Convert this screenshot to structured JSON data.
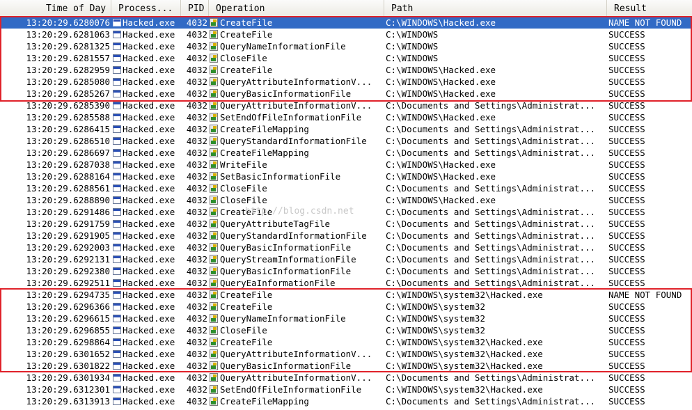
{
  "columns": {
    "time": "Time of Day",
    "process": "Process...",
    "pid": "PID",
    "operation": "Operation",
    "path": "Path",
    "result": "Result"
  },
  "watermark": "http://blog.csdn.net",
  "highlight_color": "#e0222a",
  "selection_color": "#316ac5",
  "rows": [
    {
      "time": "13:20:29.6280076",
      "process": "Hacked.exe",
      "pid": "4032",
      "operation": "CreateFile",
      "path": "C:\\WINDOWS\\Hacked.exe",
      "result": "NAME NOT FOUND",
      "selected": true
    },
    {
      "time": "13:20:29.6281063",
      "process": "Hacked.exe",
      "pid": "4032",
      "operation": "CreateFile",
      "path": "C:\\WINDOWS",
      "result": "SUCCESS"
    },
    {
      "time": "13:20:29.6281325",
      "process": "Hacked.exe",
      "pid": "4032",
      "operation": "QueryNameInformationFile",
      "path": "C:\\WINDOWS",
      "result": "SUCCESS"
    },
    {
      "time": "13:20:29.6281557",
      "process": "Hacked.exe",
      "pid": "4032",
      "operation": "CloseFile",
      "path": "C:\\WINDOWS",
      "result": "SUCCESS"
    },
    {
      "time": "13:20:29.6282959",
      "process": "Hacked.exe",
      "pid": "4032",
      "operation": "CreateFile",
      "path": "C:\\WINDOWS\\Hacked.exe",
      "result": "SUCCESS"
    },
    {
      "time": "13:20:29.6285080",
      "process": "Hacked.exe",
      "pid": "4032",
      "operation": "QueryAttributeInformationV...",
      "path": "C:\\WINDOWS\\Hacked.exe",
      "result": "SUCCESS"
    },
    {
      "time": "13:20:29.6285267",
      "process": "Hacked.exe",
      "pid": "4032",
      "operation": "QueryBasicInformationFile",
      "path": "C:\\WINDOWS\\Hacked.exe",
      "result": "SUCCESS"
    },
    {
      "time": "13:20:29.6285390",
      "process": "Hacked.exe",
      "pid": "4032",
      "operation": "QueryAttributeInformationV...",
      "path": "C:\\Documents and Settings\\Administrat...",
      "result": "SUCCESS"
    },
    {
      "time": "13:20:29.6285588",
      "process": "Hacked.exe",
      "pid": "4032",
      "operation": "SetEndOfFileInformationFile",
      "path": "C:\\WINDOWS\\Hacked.exe",
      "result": "SUCCESS"
    },
    {
      "time": "13:20:29.6286415",
      "process": "Hacked.exe",
      "pid": "4032",
      "operation": "CreateFileMapping",
      "path": "C:\\Documents and Settings\\Administrat...",
      "result": "SUCCESS"
    },
    {
      "time": "13:20:29.6286510",
      "process": "Hacked.exe",
      "pid": "4032",
      "operation": "QueryStandardInformationFile",
      "path": "C:\\Documents and Settings\\Administrat...",
      "result": "SUCCESS"
    },
    {
      "time": "13:20:29.6286697",
      "process": "Hacked.exe",
      "pid": "4032",
      "operation": "CreateFileMapping",
      "path": "C:\\Documents and Settings\\Administrat...",
      "result": "SUCCESS"
    },
    {
      "time": "13:20:29.6287038",
      "process": "Hacked.exe",
      "pid": "4032",
      "operation": "WriteFile",
      "path": "C:\\WINDOWS\\Hacked.exe",
      "result": "SUCCESS"
    },
    {
      "time": "13:20:29.6288164",
      "process": "Hacked.exe",
      "pid": "4032",
      "operation": "SetBasicInformationFile",
      "path": "C:\\WINDOWS\\Hacked.exe",
      "result": "SUCCESS"
    },
    {
      "time": "13:20:29.6288561",
      "process": "Hacked.exe",
      "pid": "4032",
      "operation": "CloseFile",
      "path": "C:\\Documents and Settings\\Administrat...",
      "result": "SUCCESS"
    },
    {
      "time": "13:20:29.6288890",
      "process": "Hacked.exe",
      "pid": "4032",
      "operation": "CloseFile",
      "path": "C:\\WINDOWS\\Hacked.exe",
      "result": "SUCCESS"
    },
    {
      "time": "13:20:29.6291486",
      "process": "Hacked.exe",
      "pid": "4032",
      "operation": "CreateFile",
      "path": "C:\\Documents and Settings\\Administrat...",
      "result": "SUCCESS"
    },
    {
      "time": "13:20:29.6291759",
      "process": "Hacked.exe",
      "pid": "4032",
      "operation": "QueryAttributeTagFile",
      "path": "C:\\Documents and Settings\\Administrat...",
      "result": "SUCCESS"
    },
    {
      "time": "13:20:29.6291905",
      "process": "Hacked.exe",
      "pid": "4032",
      "operation": "QueryStandardInformationFile",
      "path": "C:\\Documents and Settings\\Administrat...",
      "result": "SUCCESS"
    },
    {
      "time": "13:20:29.6292003",
      "process": "Hacked.exe",
      "pid": "4032",
      "operation": "QueryBasicInformationFile",
      "path": "C:\\Documents and Settings\\Administrat...",
      "result": "SUCCESS"
    },
    {
      "time": "13:20:29.6292131",
      "process": "Hacked.exe",
      "pid": "4032",
      "operation": "QueryStreamInformationFile",
      "path": "C:\\Documents and Settings\\Administrat...",
      "result": "SUCCESS"
    },
    {
      "time": "13:20:29.6292380",
      "process": "Hacked.exe",
      "pid": "4032",
      "operation": "QueryBasicInformationFile",
      "path": "C:\\Documents and Settings\\Administrat...",
      "result": "SUCCESS"
    },
    {
      "time": "13:20:29.6292511",
      "process": "Hacked.exe",
      "pid": "4032",
      "operation": "QueryEaInformationFile",
      "path": "C:\\Documents and Settings\\Administrat...",
      "result": "SUCCESS"
    },
    {
      "time": "13:20:29.6294735",
      "process": "Hacked.exe",
      "pid": "4032",
      "operation": "CreateFile",
      "path": "C:\\WINDOWS\\system32\\Hacked.exe",
      "result": "NAME NOT FOUND"
    },
    {
      "time": "13:20:29.6296366",
      "process": "Hacked.exe",
      "pid": "4032",
      "operation": "CreateFile",
      "path": "C:\\WINDOWS\\system32",
      "result": "SUCCESS"
    },
    {
      "time": "13:20:29.6296615",
      "process": "Hacked.exe",
      "pid": "4032",
      "operation": "QueryNameInformationFile",
      "path": "C:\\WINDOWS\\system32",
      "result": "SUCCESS"
    },
    {
      "time": "13:20:29.6296855",
      "process": "Hacked.exe",
      "pid": "4032",
      "operation": "CloseFile",
      "path": "C:\\WINDOWS\\system32",
      "result": "SUCCESS"
    },
    {
      "time": "13:20:29.6298864",
      "process": "Hacked.exe",
      "pid": "4032",
      "operation": "CreateFile",
      "path": "C:\\WINDOWS\\system32\\Hacked.exe",
      "result": "SUCCESS"
    },
    {
      "time": "13:20:29.6301652",
      "process": "Hacked.exe",
      "pid": "4032",
      "operation": "QueryAttributeInformationV...",
      "path": "C:\\WINDOWS\\system32\\Hacked.exe",
      "result": "SUCCESS"
    },
    {
      "time": "13:20:29.6301822",
      "process": "Hacked.exe",
      "pid": "4032",
      "operation": "QueryBasicInformationFile",
      "path": "C:\\WINDOWS\\system32\\Hacked.exe",
      "result": "SUCCESS"
    },
    {
      "time": "13:20:29.6301934",
      "process": "Hacked.exe",
      "pid": "4032",
      "operation": "QueryAttributeInformationV...",
      "path": "C:\\Documents and Settings\\Administrat...",
      "result": "SUCCESS"
    },
    {
      "time": "13:20:29.6312301",
      "process": "Hacked.exe",
      "pid": "4032",
      "operation": "SetEndOfFileInformationFile",
      "path": "C:\\WINDOWS\\system32\\Hacked.exe",
      "result": "SUCCESS"
    },
    {
      "time": "13:20:29.6313913",
      "process": "Hacked.exe",
      "pid": "4032",
      "operation": "CreateFileMapping",
      "path": "C:\\Documents and Settings\\Administrat...",
      "result": "SUCCESS"
    }
  ]
}
